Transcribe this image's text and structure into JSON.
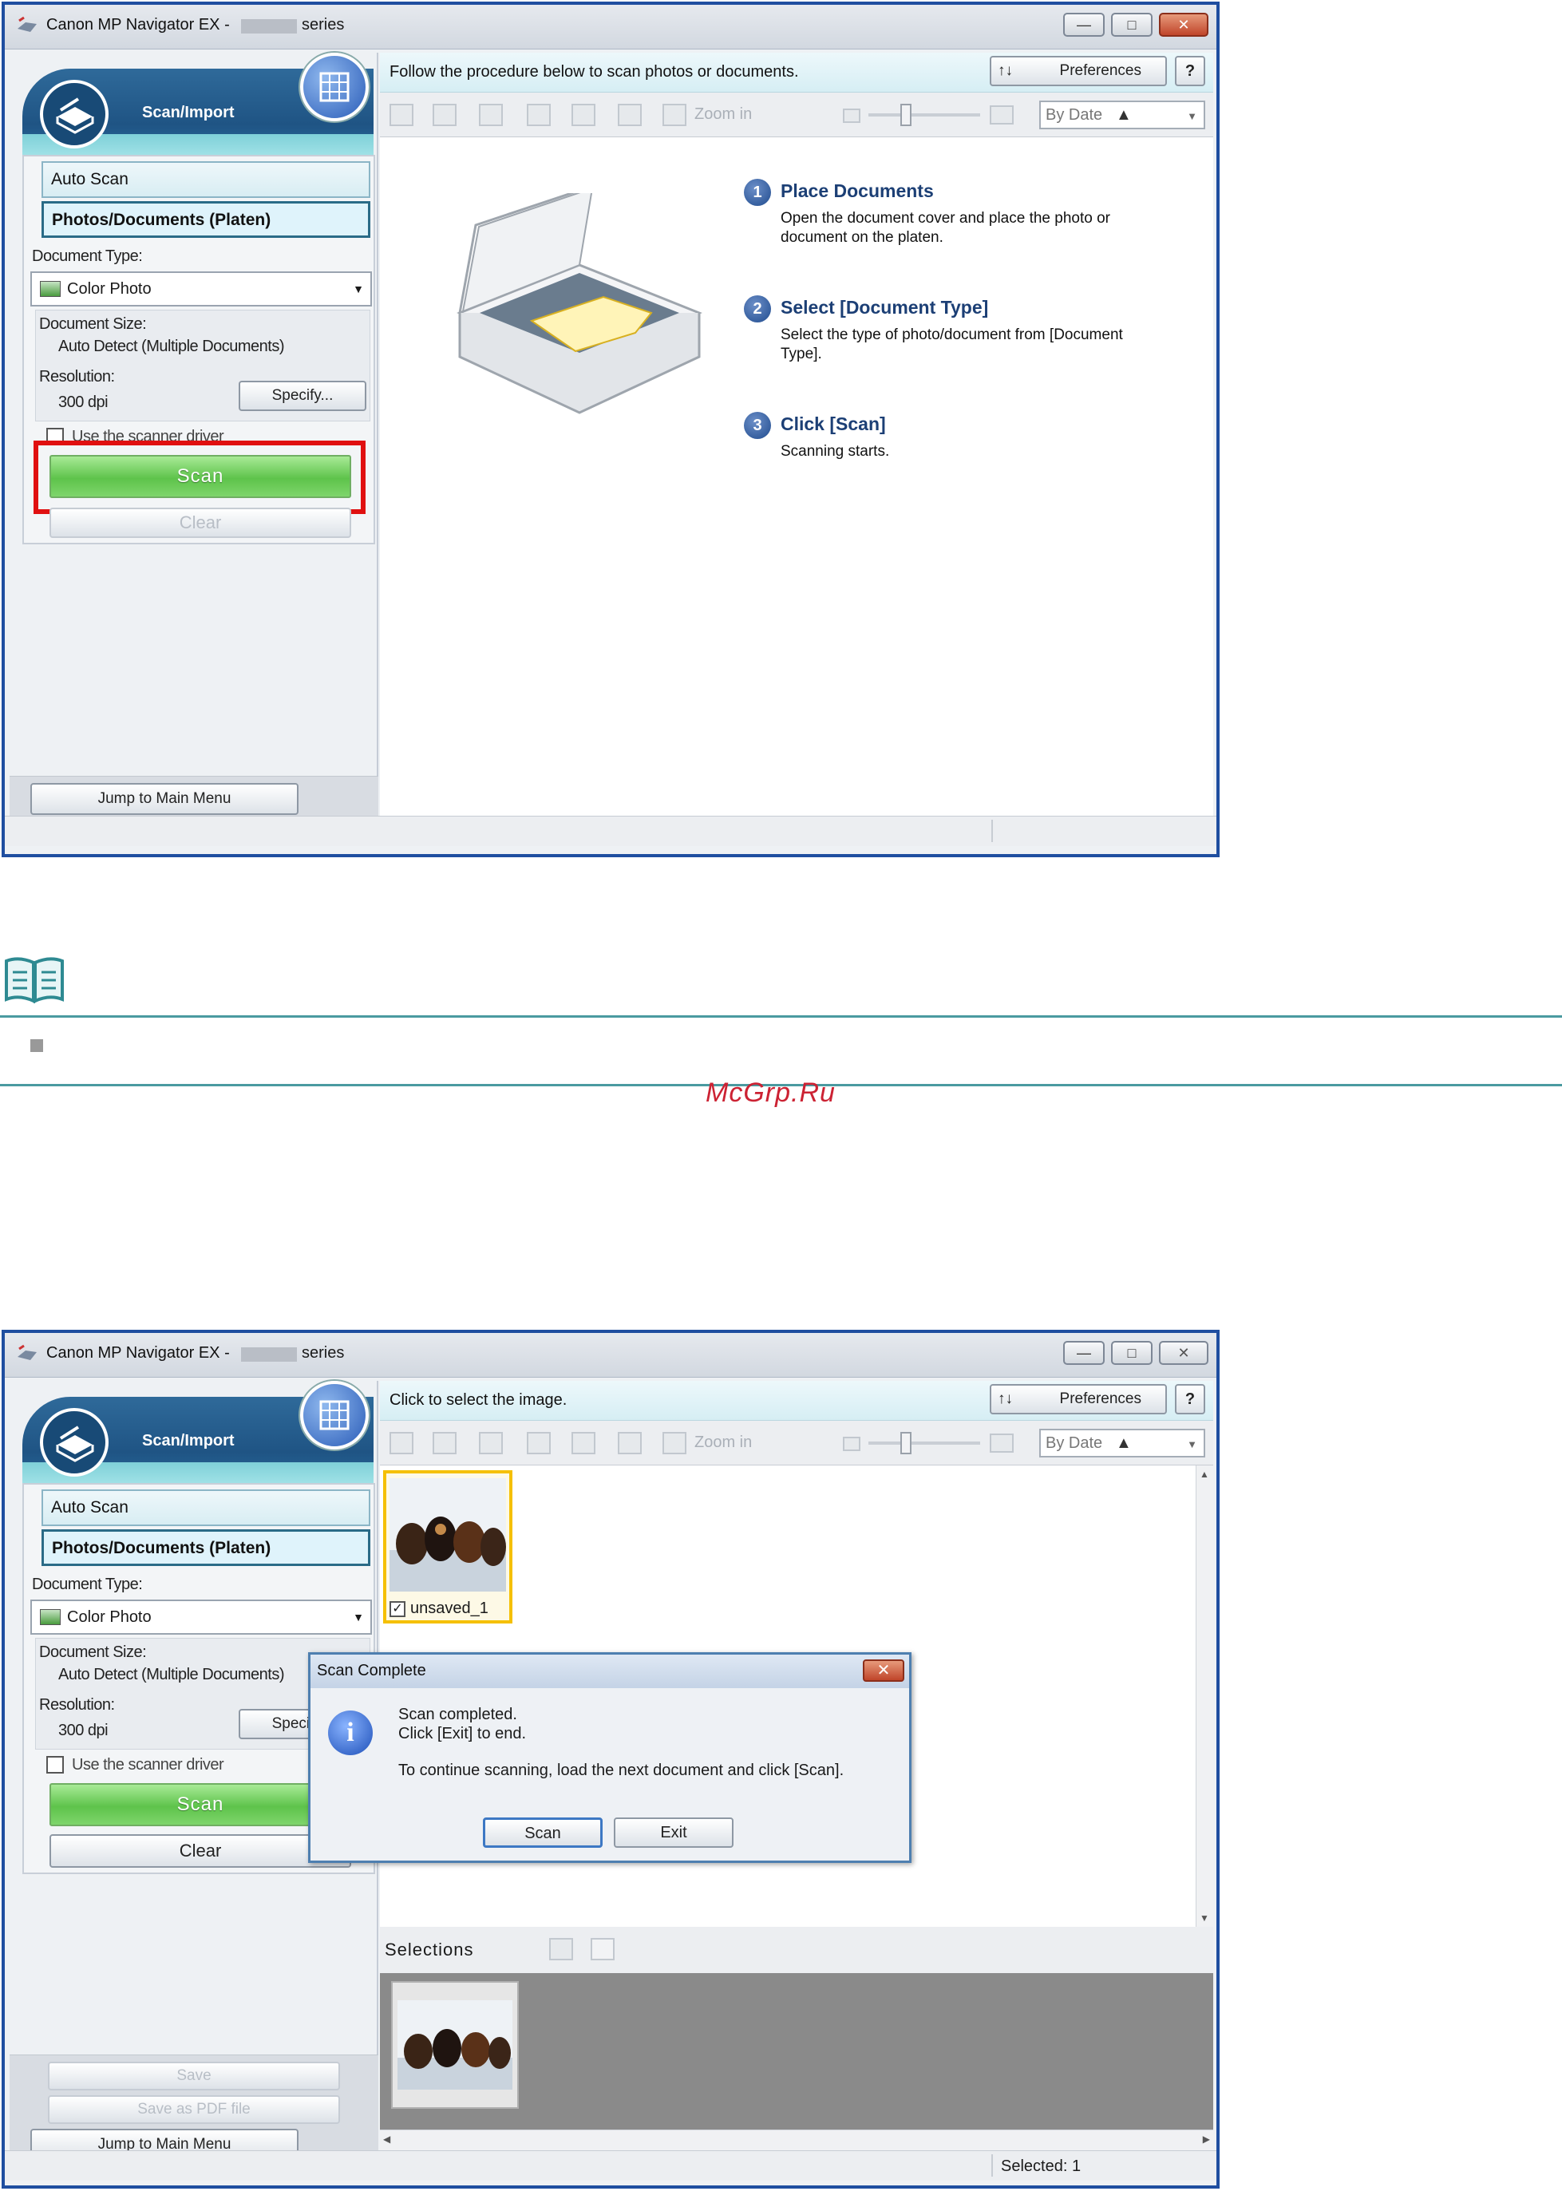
{
  "top_window": {
    "title": "Canon MP Navigator EX -",
    "title_suffix": "series",
    "panel_header": "Scan/Import",
    "modes": [
      "Auto Scan",
      "Photos/Documents (Platen)"
    ],
    "document_type_label": "Document Type:",
    "document_type_value": "Color Photo",
    "document_size_label": "Document Size:",
    "document_size_value": "Auto Detect (Multiple Documents)",
    "resolution_label": "Resolution:",
    "resolution_value": "300 dpi",
    "specify_label": "Specify...",
    "scanner_driver_label": "Use the scanner driver",
    "scan_label": "Scan",
    "clear_label": "Clear",
    "jump_label": "Jump to Main Menu",
    "instruction": "Follow the procedure below to scan photos or documents.",
    "preferences_label": "Preferences",
    "help_label": "?",
    "zoom_label": "Zoom in",
    "sort_label": "By Date",
    "steps": [
      {
        "num": "1",
        "title": "Place Documents",
        "desc1": "Open the document cover and place the photo or",
        "desc2": "document on the platen."
      },
      {
        "num": "2",
        "title": "Select [Document Type]",
        "desc1": "Select the type of photo/document from [Document",
        "desc2": "Type]."
      },
      {
        "num": "3",
        "title": "Click [Scan]",
        "desc1": "Scanning starts.",
        "desc2": ""
      }
    ]
  },
  "watermark": "McGrp.Ru",
  "bottom_window": {
    "title": "Canon MP Navigator EX -",
    "title_suffix": "series",
    "panel_header": "Scan/Import",
    "modes": [
      "Auto Scan",
      "Photos/Documents (Platen)"
    ],
    "document_type_label": "Document Type:",
    "document_type_value": "Color Photo",
    "document_size_label": "Document Size:",
    "document_size_value": "Auto Detect (Multiple Documents)",
    "resolution_label": "Resolution:",
    "resolution_value": "300 dpi",
    "specify_label": "Specify...",
    "scanner_driver_label": "Use the scanner driver",
    "scan_label": "Scan",
    "clear_label": "Clear",
    "save_label": "Save",
    "save_pdf_label": "Save as PDF file",
    "jump_label": "Jump to Main Menu",
    "instruction": "Click to select the image.",
    "preferences_label": "Preferences",
    "help_label": "?",
    "zoom_label": "Zoom in",
    "sort_label": "By Date",
    "thumbnail_label": "unsaved_1",
    "selections_label": "Selections",
    "status_selected": "Selected: 1",
    "dialog": {
      "title": "Scan Complete",
      "line1": "Scan completed.",
      "line2": "Click [Exit] to end.",
      "line3": "To continue scanning, load the next document and click [Scan].",
      "scan_button": "Scan",
      "exit_button": "Exit"
    }
  },
  "colors": {
    "accent_frame": "#1f4ea0",
    "highlight_red": "#e01010",
    "scan_green": "#5ec34b",
    "note_rule": "#4a9aa0"
  }
}
